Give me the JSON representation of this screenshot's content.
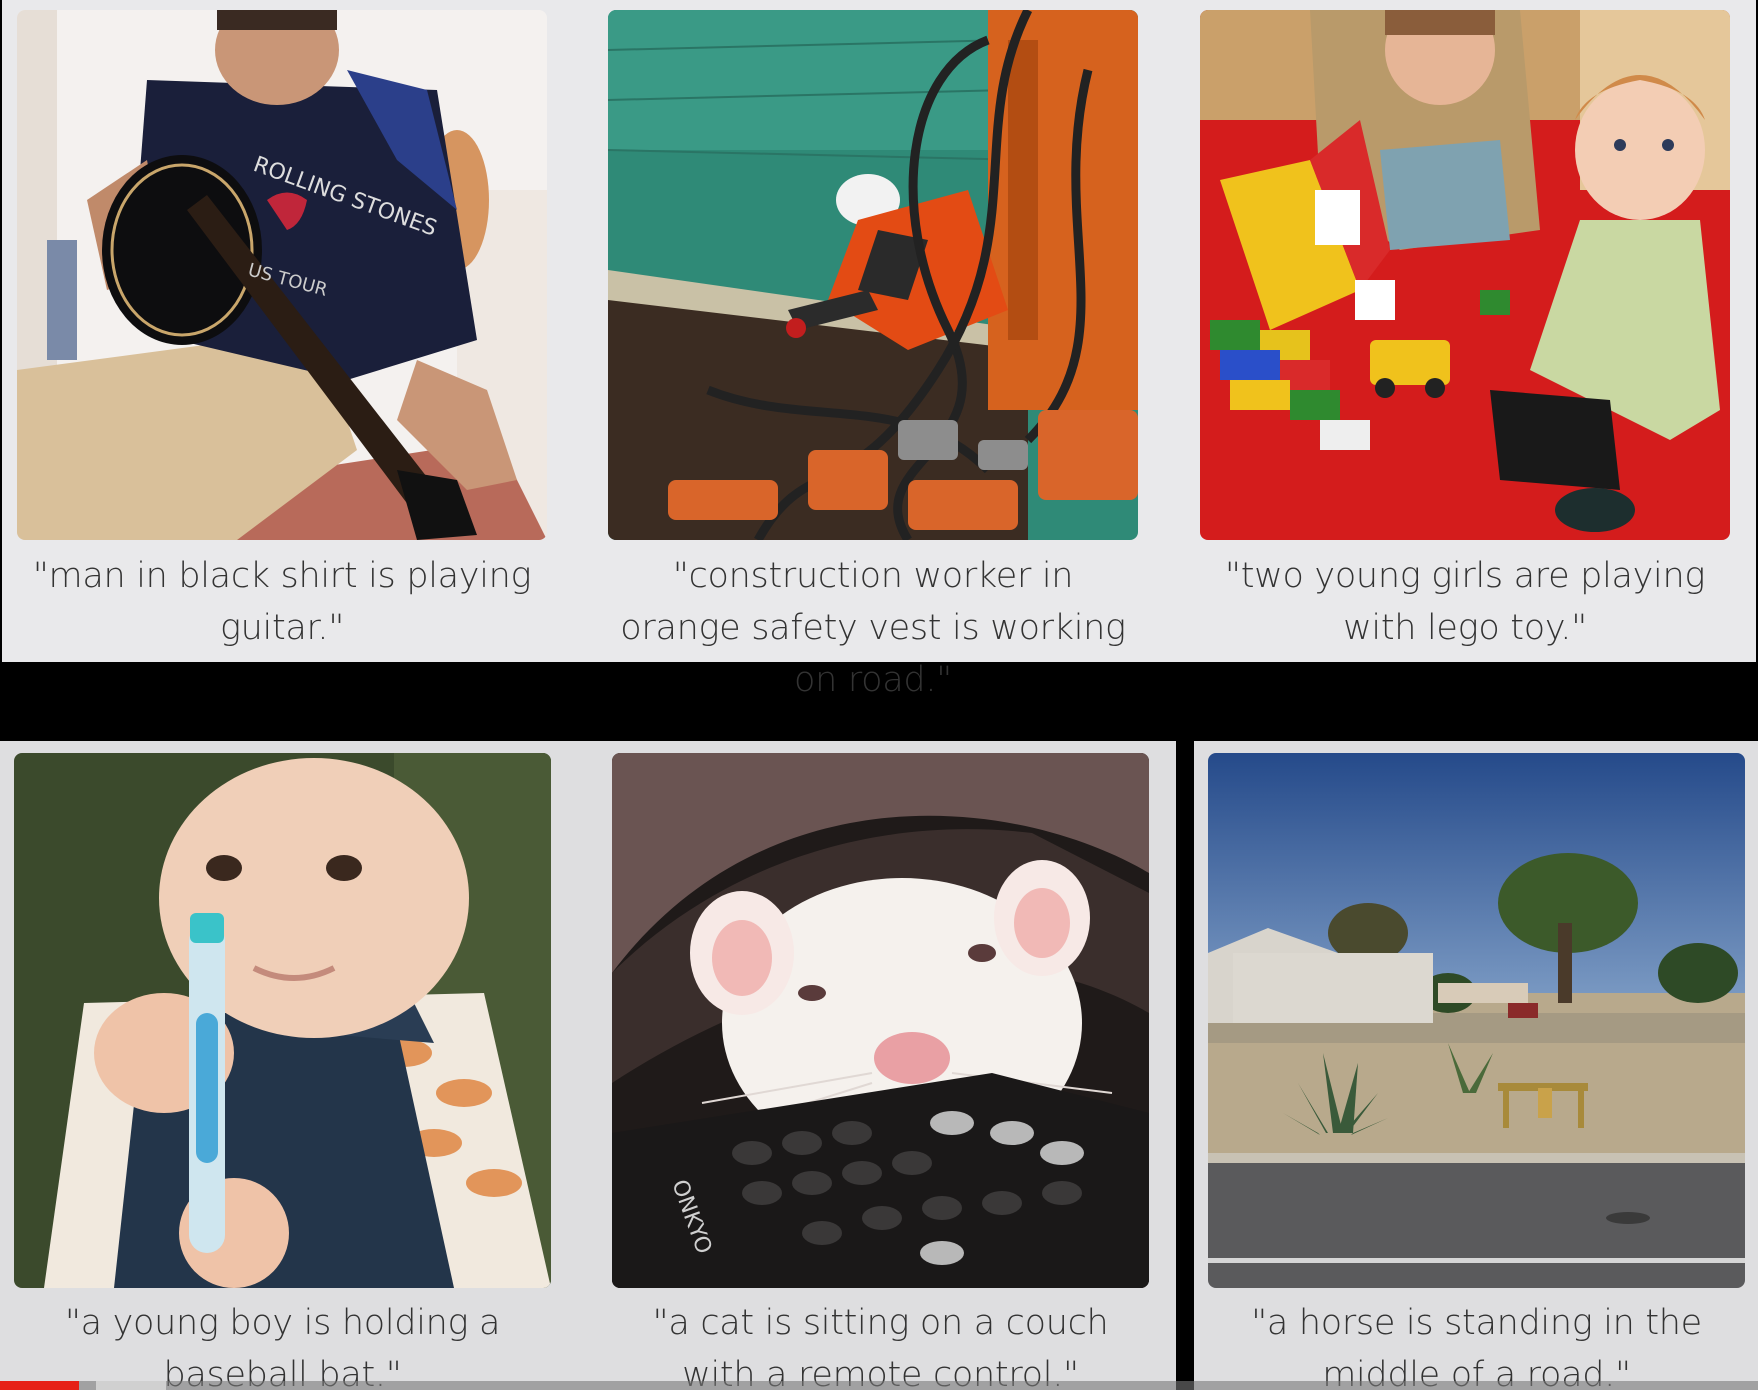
{
  "captions": {
    "guitar": "\"man in black shirt is playing guitar.\"",
    "construction": "\"construction worker in orange safety vest is working on road.\"",
    "lego": "\"two young girls are playing with lego toy.\"",
    "baby": "\"a young boy is holding a baseball bat.\"",
    "ferret": "\"a cat is sitting on a couch with a remote control.\"",
    "road": "\"a horse is standing in the middle of a road.\""
  },
  "shirt_text": {
    "line1": "ROLLING STONES",
    "line2": "US TOUR"
  },
  "remote_brand": "ONKYO",
  "video_progress": {
    "played_fraction": 0.045
  },
  "colors": {
    "panel": "#e9e9eb",
    "caption": "#333333",
    "progress_played": "#e62117"
  }
}
